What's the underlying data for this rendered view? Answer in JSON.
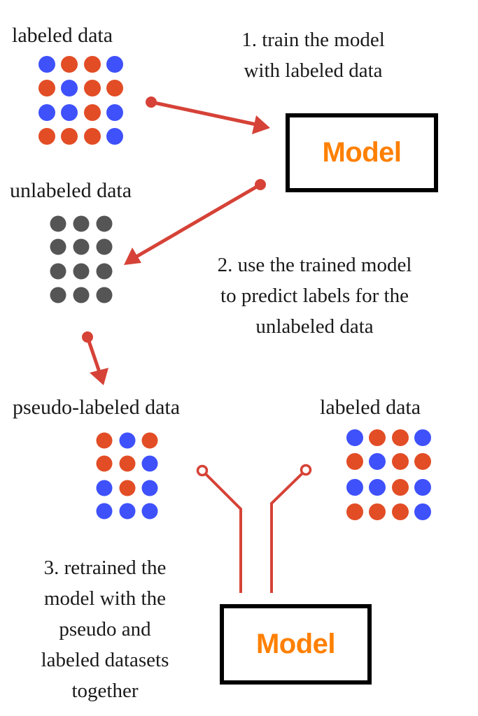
{
  "colors": {
    "blue": "#3f51fb",
    "red": "#e24d26",
    "gray": "#555555",
    "arrow": "#d64237",
    "model_text": "#ff8000",
    "box_border": "#000000"
  },
  "labels": {
    "labeled_top": "labeled data",
    "unlabeled": "unlabeled data",
    "pseudo": "pseudo-labeled data",
    "labeled_bottom": "labeled data"
  },
  "steps": {
    "step1": [
      "1. train the model",
      "with labeled data"
    ],
    "step2": [
      "2. use the trained model",
      "to predict labels for the",
      "unlabeled data"
    ],
    "step3": [
      "3. retrained the",
      "model with the",
      "pseudo and",
      "labeled datasets",
      "together"
    ]
  },
  "models": {
    "top": "Model",
    "bottom": "Model"
  },
  "grids": {
    "labeled_top": [
      [
        "blue",
        "red",
        "red",
        "blue"
      ],
      [
        "red",
        "blue",
        "red",
        "red"
      ],
      [
        "blue",
        "blue",
        "red",
        "blue"
      ],
      [
        "red",
        "red",
        "red",
        "blue"
      ]
    ],
    "unlabeled": [
      [
        "gray",
        "gray",
        "gray"
      ],
      [
        "gray",
        "gray",
        "gray"
      ],
      [
        "gray",
        "gray",
        "gray"
      ],
      [
        "gray",
        "gray",
        "gray"
      ]
    ],
    "pseudo": [
      [
        "red",
        "blue",
        "red"
      ],
      [
        "red",
        "red",
        "blue"
      ],
      [
        "blue",
        "red",
        "blue"
      ],
      [
        "blue",
        "blue",
        "blue"
      ]
    ],
    "labeled_bottom": [
      [
        "blue",
        "red",
        "red",
        "blue"
      ],
      [
        "red",
        "blue",
        "red",
        "red"
      ],
      [
        "blue",
        "blue",
        "red",
        "blue"
      ],
      [
        "red",
        "red",
        "red",
        "blue"
      ]
    ]
  }
}
